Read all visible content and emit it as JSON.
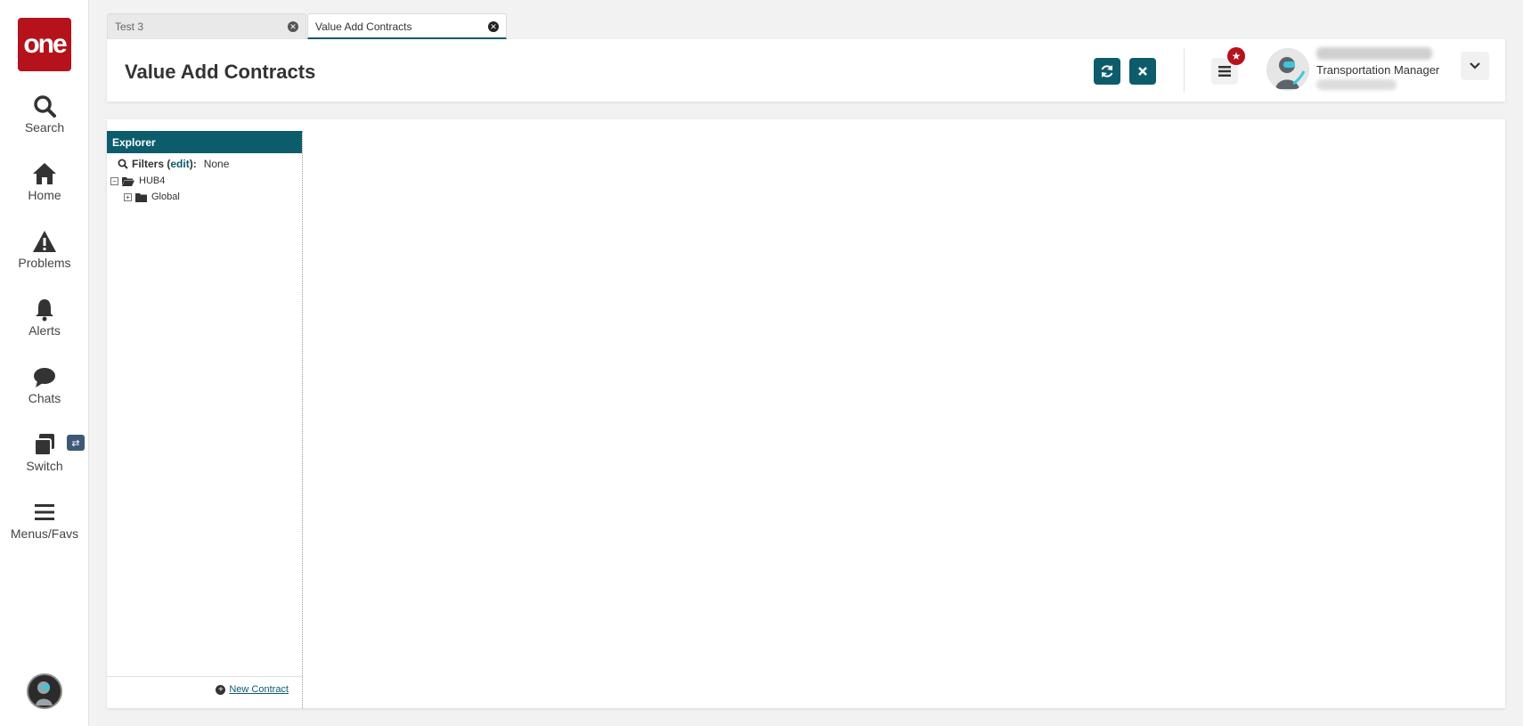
{
  "app": {
    "logo_text": "one",
    "brand_color": "#b5121b",
    "accent_color": "#0c5c6c"
  },
  "nav": {
    "items": [
      {
        "label": "Search",
        "icon": "search-icon"
      },
      {
        "label": "Home",
        "icon": "home-icon"
      },
      {
        "label": "Problems",
        "icon": "warning-icon"
      },
      {
        "label": "Alerts",
        "icon": "bell-icon"
      },
      {
        "label": "Chats",
        "icon": "chat-icon"
      },
      {
        "label": "Switch",
        "icon": "switch-icon"
      },
      {
        "label": "Menus/Favs",
        "icon": "menu-icon"
      }
    ],
    "switch_badge_icon": "swap-icon"
  },
  "tabs": [
    {
      "label": "Test 3",
      "active": false
    },
    {
      "label": "Value Add Contracts",
      "active": true
    }
  ],
  "header": {
    "title": "Value Add Contracts",
    "refresh_icon": "refresh-icon",
    "close_icon": "close-icon",
    "menu_icon": "list-icon",
    "badge_icon": "star-icon",
    "user": {
      "role": "Transportation Manager"
    }
  },
  "explorer": {
    "title": "Explorer",
    "filters_label": "Filters",
    "filters_edit": "edit",
    "filters_value": "None",
    "tree": [
      {
        "label": "HUB4",
        "expanded": true,
        "level": 0
      },
      {
        "label": "Global",
        "expanded": false,
        "level": 1
      }
    ],
    "new_contract_label": "New Contract"
  }
}
